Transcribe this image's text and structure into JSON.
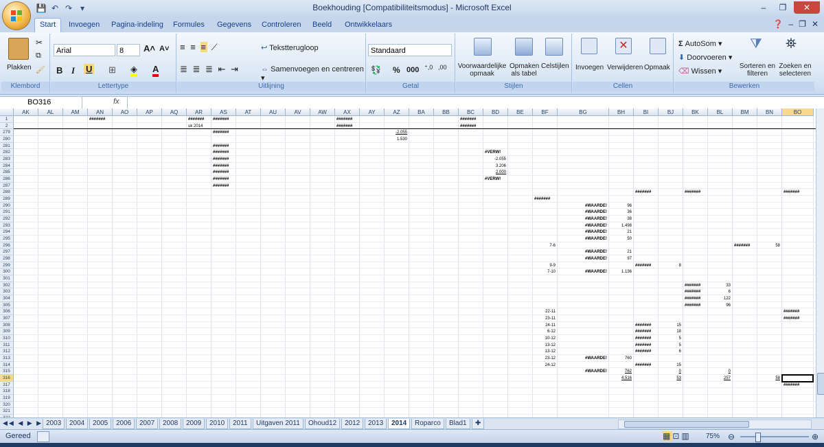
{
  "window": {
    "title": "Boekhouding  [Compatibiliteitsmodus] - Microsoft Excel"
  },
  "ribbon_tabs": [
    "Start",
    "Invoegen",
    "Pagina-indeling",
    "Formules",
    "Gegevens",
    "Controleren",
    "Beeld",
    "Ontwikkelaars"
  ],
  "clipboard": {
    "paste": "Plakken",
    "group": "Klembord"
  },
  "font": {
    "name": "Arial",
    "size": "8",
    "group": "Lettertype",
    "bold": "B",
    "italic": "I",
    "underline": "U"
  },
  "alignment": {
    "wrap": "Tekstterugloop",
    "merge": "Samenvoegen en centreren",
    "group": "Uitlijning"
  },
  "number": {
    "format": "Standaard",
    "percent": "%",
    "thousands": "000",
    "group": "Getal"
  },
  "styles": {
    "conditional": "Voorwaardelijke opmaak",
    "table": "Opmaken als tabel",
    "cell": "Celstijlen",
    "group": "Stijlen"
  },
  "cells": {
    "insert": "Invoegen",
    "delete": "Verwijderen",
    "format": "Opmaak",
    "group": "Cellen"
  },
  "editing": {
    "autosum": "AutoSom",
    "fill": "Doorvoeren",
    "clear": "Wissen",
    "sort": "Sorteren en filteren",
    "find": "Zoeken en selecteren",
    "group": "Bewerken"
  },
  "formula_bar": {
    "namebox": "BO316",
    "fx": "fx",
    "content": ""
  },
  "columns": [
    "AK",
    "AL",
    "AM",
    "AN",
    "AO",
    "AP",
    "AQ",
    "AR",
    "AS",
    "AT",
    "AU",
    "AV",
    "AW",
    "AX",
    "AY",
    "AZ",
    "BA",
    "BB",
    "BC",
    "BD",
    "BE",
    "BF",
    "BG",
    "BH",
    "BI",
    "BJ",
    "BK",
    "BL",
    "BM",
    "BN",
    "BO"
  ],
  "rows": [
    "1",
    "2",
    "279",
    "280",
    "281",
    "282",
    "283",
    "284",
    "285",
    "286",
    "287",
    "288",
    "289",
    "290",
    "291",
    "292",
    "293",
    "294",
    "295",
    "296",
    "297",
    "298",
    "299",
    "300",
    "301",
    "302",
    "303",
    "304",
    "305",
    "306",
    "307",
    "308",
    "309",
    "310",
    "311",
    "312",
    "313",
    "314",
    "315",
    "316",
    "317",
    "318",
    "319",
    "320",
    "321",
    "322"
  ],
  "cells_content": [
    {
      "col": "AN",
      "row": "1",
      "v": "#######"
    },
    {
      "col": "AR",
      "row": "1",
      "v": "#######"
    },
    {
      "col": "AS",
      "row": "1",
      "v": "#######"
    },
    {
      "col": "AX",
      "row": "1",
      "v": "#######"
    },
    {
      "col": "BC",
      "row": "1",
      "v": "#######"
    },
    {
      "col": "AR",
      "row": "2",
      "v": "uk 2014"
    },
    {
      "col": "AX",
      "row": "2",
      "v": "#######"
    },
    {
      "col": "BC",
      "row": "2",
      "v": "#######"
    },
    {
      "col": "AS",
      "row": "279",
      "v": "#######"
    },
    {
      "col": "AZ",
      "row": "279",
      "v": "-2.055",
      "r": true,
      "u": true
    },
    {
      "col": "AZ",
      "row": "280",
      "v": "1.530",
      "r": true
    },
    {
      "col": "AS",
      "row": "281",
      "v": "#######"
    },
    {
      "col": "AS",
      "row": "282",
      "v": "#######"
    },
    {
      "col": "BD",
      "row": "282",
      "v": "#VERW!"
    },
    {
      "col": "AS",
      "row": "283",
      "v": "#######"
    },
    {
      "col": "BD",
      "row": "283",
      "v": "-2.055",
      "r": true
    },
    {
      "col": "AS",
      "row": "284",
      "v": "#######"
    },
    {
      "col": "BD",
      "row": "284",
      "v": "3.206",
      "r": true
    },
    {
      "col": "AS",
      "row": "285",
      "v": "#######"
    },
    {
      "col": "BD",
      "row": "285",
      "v": "2.000",
      "r": true,
      "u": true
    },
    {
      "col": "AS",
      "row": "286",
      "v": "#######"
    },
    {
      "col": "BD",
      "row": "286",
      "v": "#VERW!"
    },
    {
      "col": "AS",
      "row": "287",
      "v": "#######"
    },
    {
      "col": "BI",
      "row": "288",
      "v": "#######"
    },
    {
      "col": "BK",
      "row": "288",
      "v": "#######"
    },
    {
      "col": "BO",
      "row": "288",
      "v": "#######"
    },
    {
      "col": "BF",
      "row": "289",
      "v": "#######"
    },
    {
      "col": "BG",
      "row": "290",
      "v": "#WAARDE!",
      "r": true
    },
    {
      "col": "BH",
      "row": "290",
      "v": "96",
      "r": true
    },
    {
      "col": "BG",
      "row": "291",
      "v": "#WAARDE!",
      "r": true
    },
    {
      "col": "BH",
      "row": "291",
      "v": "36",
      "r": true
    },
    {
      "col": "BG",
      "row": "292",
      "v": "#WAARDE!",
      "r": true
    },
    {
      "col": "BH",
      "row": "292",
      "v": "38",
      "r": true
    },
    {
      "col": "BG",
      "row": "293",
      "v": "#WAARDE!",
      "r": true
    },
    {
      "col": "BH",
      "row": "293",
      "v": "1.498",
      "r": true
    },
    {
      "col": "BG",
      "row": "294",
      "v": "#WAARDE!",
      "r": true
    },
    {
      "col": "BH",
      "row": "294",
      "v": "21",
      "r": true
    },
    {
      "col": "BG",
      "row": "295",
      "v": "#WAARDE!",
      "r": true
    },
    {
      "col": "BH",
      "row": "295",
      "v": "50",
      "r": true
    },
    {
      "col": "BF",
      "row": "296",
      "v": "7-6",
      "r": true
    },
    {
      "col": "BM",
      "row": "296",
      "v": "#######"
    },
    {
      "col": "BN",
      "row": "296",
      "v": "58",
      "r": true
    },
    {
      "col": "BG",
      "row": "297",
      "v": "#WAARDE!",
      "r": true
    },
    {
      "col": "BH",
      "row": "297",
      "v": "21",
      "r": true
    },
    {
      "col": "BG",
      "row": "298",
      "v": "#WAARDE!",
      "r": true
    },
    {
      "col": "BH",
      "row": "298",
      "v": "97",
      "r": true
    },
    {
      "col": "BF",
      "row": "299",
      "v": "9-9",
      "r": true
    },
    {
      "col": "BI",
      "row": "299",
      "v": "#######"
    },
    {
      "col": "BJ",
      "row": "299",
      "v": "8",
      "r": true
    },
    {
      "col": "BF",
      "row": "300",
      "v": "7-10",
      "r": true
    },
    {
      "col": "BG",
      "row": "300",
      "v": "#WAARDE!",
      "r": true
    },
    {
      "col": "BH",
      "row": "300",
      "v": "1.136",
      "r": true
    },
    {
      "col": "BK",
      "row": "302",
      "v": "#######"
    },
    {
      "col": "BL",
      "row": "302",
      "v": "33",
      "r": true
    },
    {
      "col": "BK",
      "row": "303",
      "v": "#######"
    },
    {
      "col": "BL",
      "row": "303",
      "v": "6",
      "r": true
    },
    {
      "col": "BK",
      "row": "304",
      "v": "#######"
    },
    {
      "col": "BL",
      "row": "304",
      "v": "122",
      "r": true
    },
    {
      "col": "BK",
      "row": "305",
      "v": "#######"
    },
    {
      "col": "BL",
      "row": "305",
      "v": "96",
      "r": true
    },
    {
      "col": "BF",
      "row": "306",
      "v": "22-11",
      "r": true
    },
    {
      "col": "BO",
      "row": "306",
      "v": "#######"
    },
    {
      "col": "BF",
      "row": "307",
      "v": "23-11",
      "r": true
    },
    {
      "col": "BO",
      "row": "307",
      "v": "#######"
    },
    {
      "col": "BF",
      "row": "308",
      "v": "24-11",
      "r": true
    },
    {
      "col": "BI",
      "row": "308",
      "v": "#######"
    },
    {
      "col": "BJ",
      "row": "308",
      "v": "15",
      "r": true
    },
    {
      "col": "BF",
      "row": "309",
      "v": "6-12",
      "r": true
    },
    {
      "col": "BI",
      "row": "309",
      "v": "#######"
    },
    {
      "col": "BJ",
      "row": "309",
      "v": "18",
      "r": true
    },
    {
      "col": "BF",
      "row": "310",
      "v": "10-12",
      "r": true
    },
    {
      "col": "BI",
      "row": "310",
      "v": "#######"
    },
    {
      "col": "BJ",
      "row": "310",
      "v": "5",
      "r": true
    },
    {
      "col": "BF",
      "row": "311",
      "v": "13-12",
      "r": true
    },
    {
      "col": "BI",
      "row": "311",
      "v": "#######"
    },
    {
      "col": "BJ",
      "row": "311",
      "v": "5",
      "r": true
    },
    {
      "col": "BF",
      "row": "312",
      "v": "13-12",
      "r": true
    },
    {
      "col": "BI",
      "row": "312",
      "v": "#######"
    },
    {
      "col": "BJ",
      "row": "312",
      "v": "6",
      "r": true
    },
    {
      "col": "BF",
      "row": "313",
      "v": "23-12",
      "r": true
    },
    {
      "col": "BG",
      "row": "313",
      "v": "#WAARDE!",
      "r": true
    },
    {
      "col": "BH",
      "row": "313",
      "v": "760",
      "r": true
    },
    {
      "col": "BF",
      "row": "314",
      "v": "24-12",
      "r": true
    },
    {
      "col": "BI",
      "row": "314",
      "v": "#######"
    },
    {
      "col": "BJ",
      "row": "314",
      "v": "15",
      "r": true
    },
    {
      "col": "BG",
      "row": "315",
      "v": "#WAARDE!",
      "r": true
    },
    {
      "col": "BH",
      "row": "315",
      "v": "762",
      "r": true,
      "u": true
    },
    {
      "col": "BJ",
      "row": "315",
      "v": "0",
      "r": true,
      "u": true
    },
    {
      "col": "BL",
      "row": "315",
      "v": "0",
      "r": true,
      "u": true
    },
    {
      "col": "BH",
      "row": "316",
      "v": "4.516",
      "r": true,
      "u": true
    },
    {
      "col": "BJ",
      "row": "316",
      "v": "53",
      "r": true,
      "u": true
    },
    {
      "col": "BL",
      "row": "316",
      "v": "257",
      "r": true,
      "u": true
    },
    {
      "col": "BN",
      "row": "316",
      "v": "58",
      "r": true,
      "u": true
    },
    {
      "col": "BO",
      "row": "317",
      "v": "#######"
    }
  ],
  "sheets": [
    "2003",
    "2004",
    "2005",
    "2006",
    "2007",
    "2008",
    "2009",
    "2010",
    "2011",
    "Uitgaven 2011",
    "Ohoud12",
    "2012",
    "2013",
    "2014",
    "Roparco",
    "Blad1"
  ],
  "active_sheet": "2014",
  "status": {
    "ready": "Gereed",
    "zoom": "75%"
  }
}
